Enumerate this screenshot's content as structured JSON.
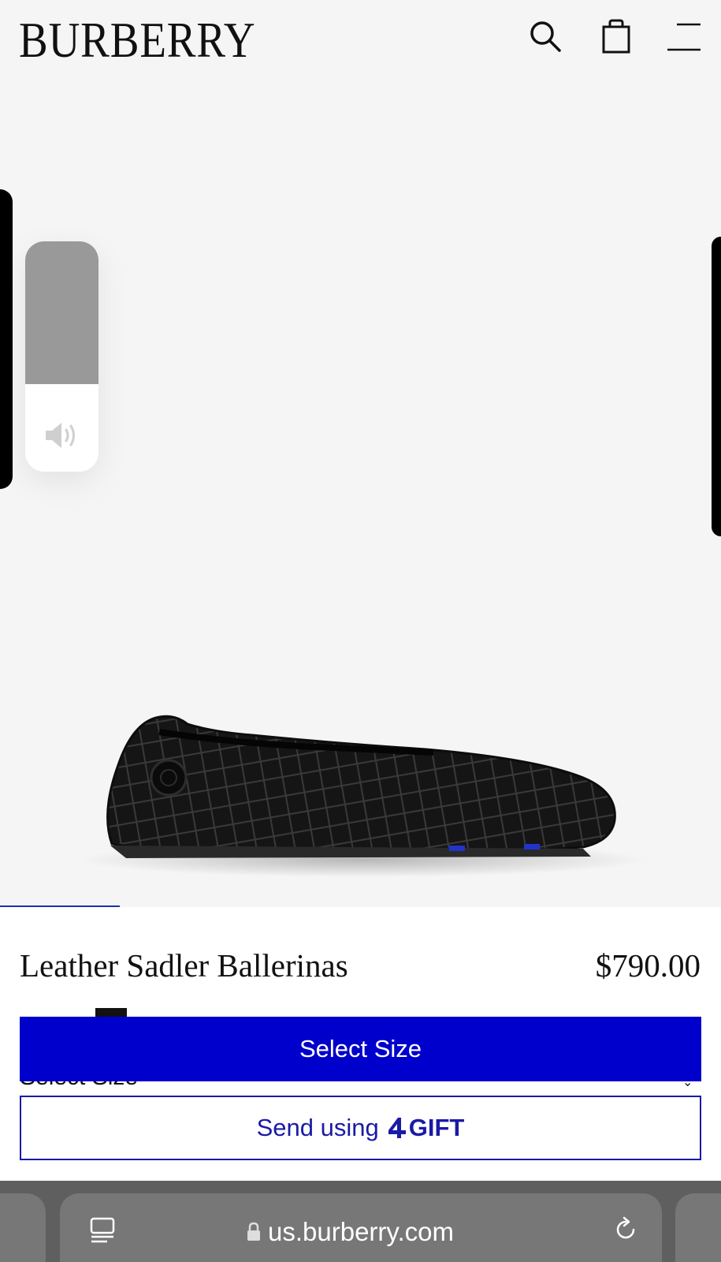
{
  "header": {
    "logo": "BURBERRY",
    "search_icon": "search-icon",
    "bag_icon": "shopping-bag-icon",
    "menu_icon": "menu-icon"
  },
  "volume": {
    "level": 0.62,
    "icon": "speaker-icon"
  },
  "product": {
    "title": "Leather Sadler Ballerinas",
    "price": "$790.00",
    "image_alt": "black quilted leather ballerina shoe"
  },
  "actions": {
    "select_size": "Select Size",
    "gift_prefix": "Send using",
    "gift_brand": "GIFT",
    "gift_icon": "gift-logo-icon"
  },
  "colors": {
    "primary_button": "#0000cc",
    "gift_border": "#1a1aa6",
    "gallery_bg": "#f5f5f5"
  },
  "browser": {
    "url": "us.burberry.com",
    "tabs_icon": "tabs-icon",
    "lock_icon": "lock-icon",
    "reload_icon": "reload-icon"
  }
}
